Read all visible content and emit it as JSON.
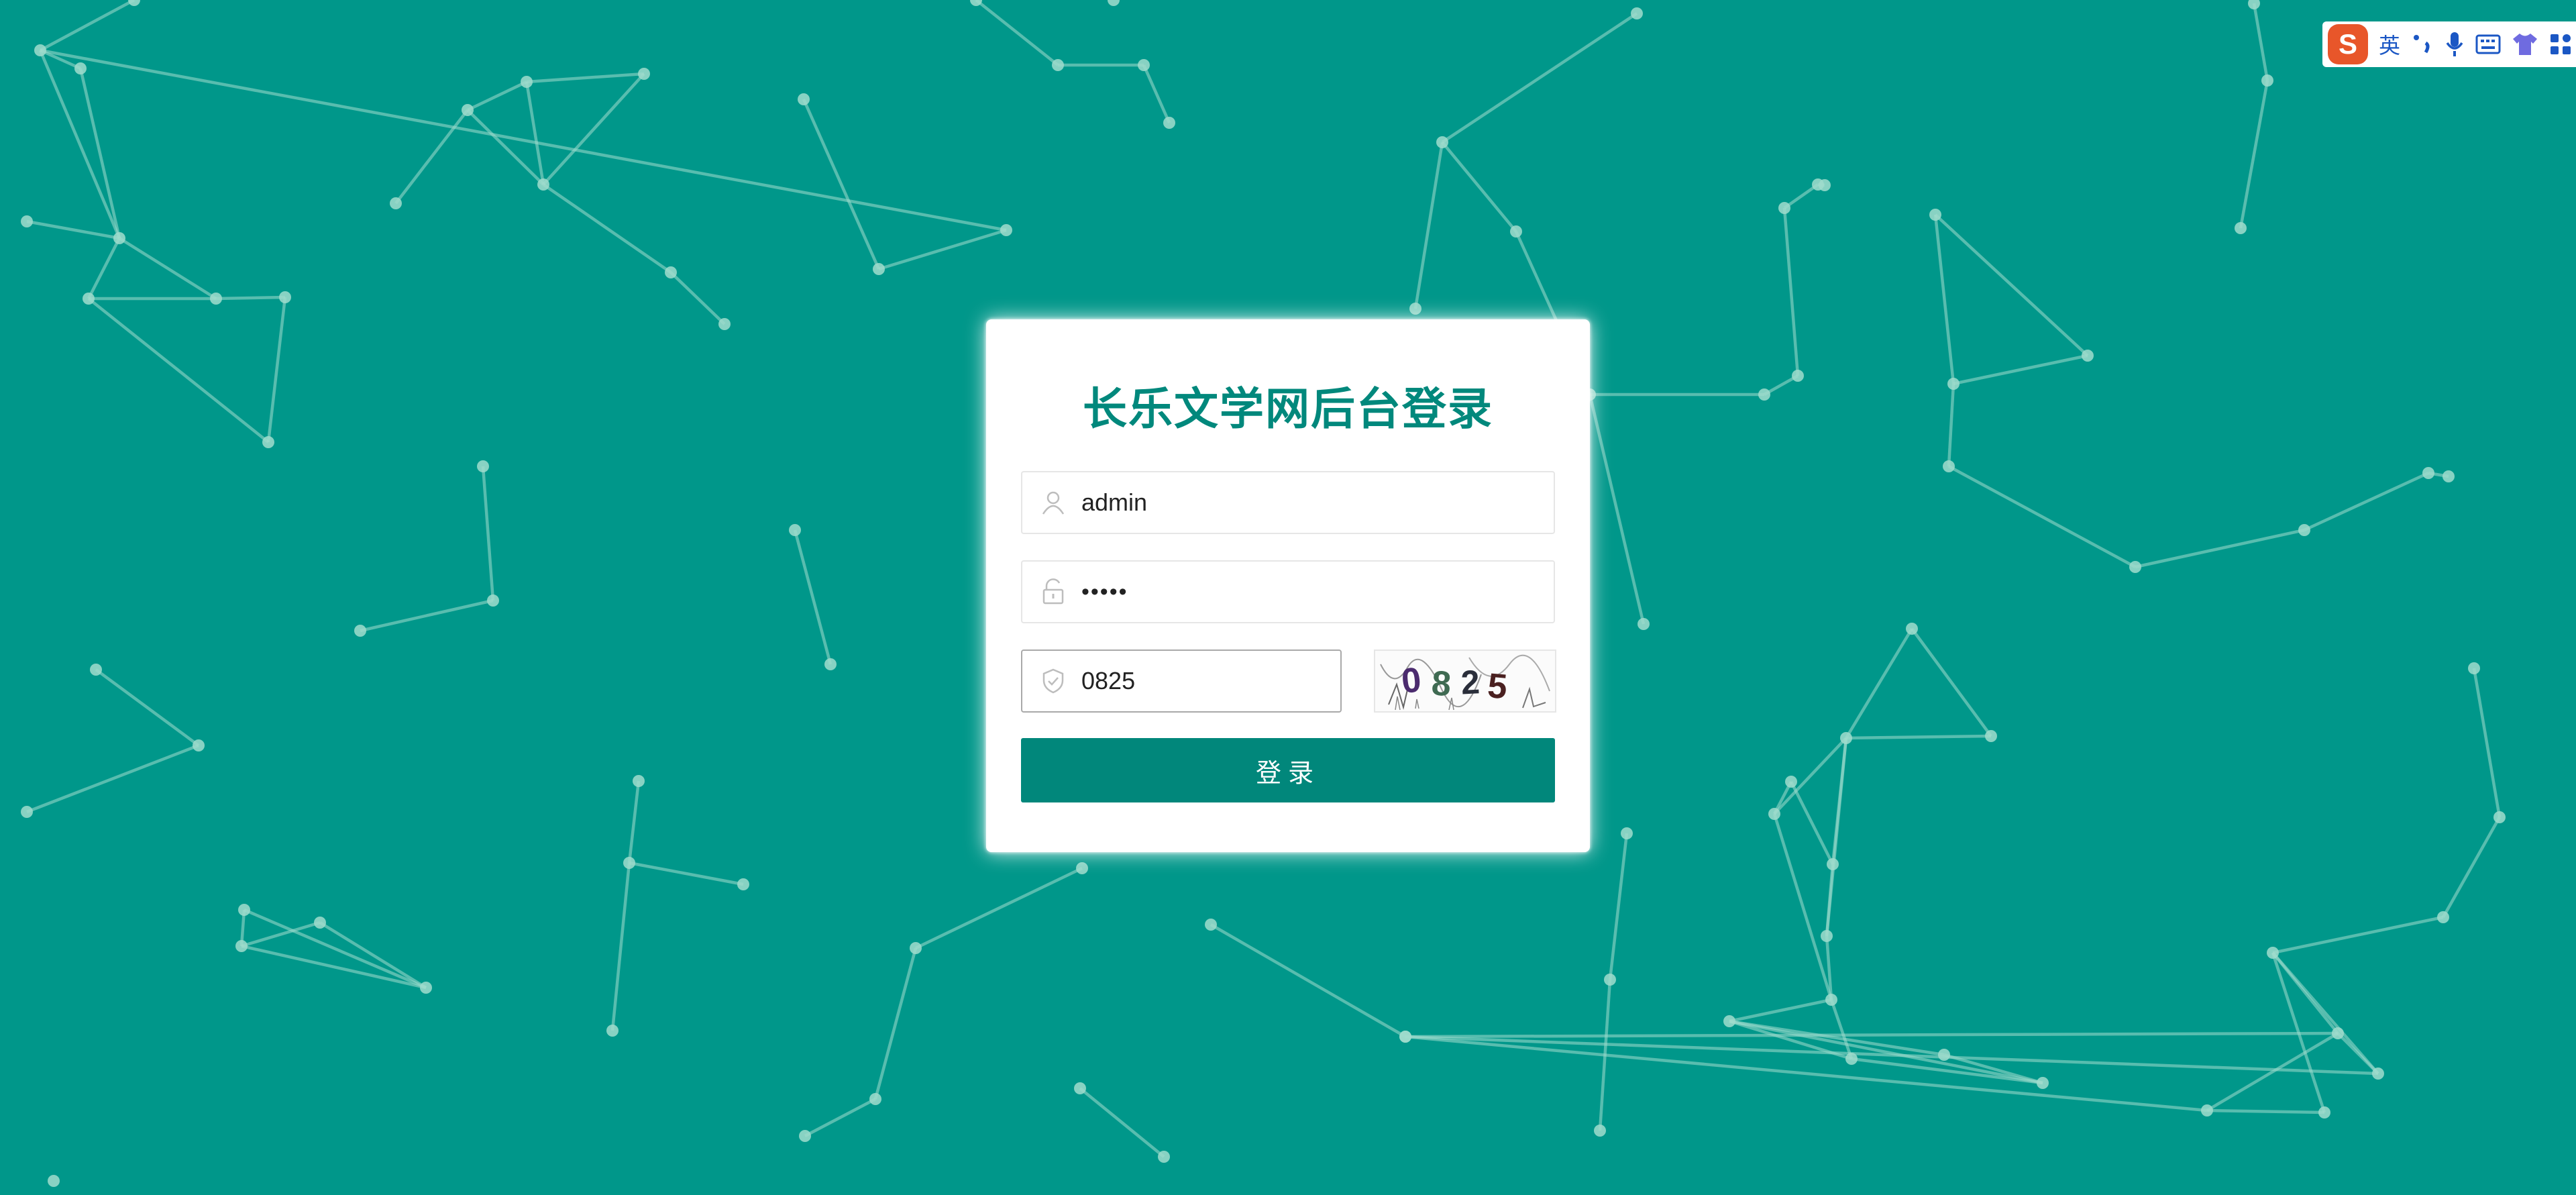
{
  "colors": {
    "background": "#00978a",
    "accent": "#01877b",
    "title": "#01887c",
    "network": "#a0dccd"
  },
  "ime_toolbar": {
    "logo": "S",
    "mode_label": "英",
    "icons": [
      "punctuation-icon",
      "microphone-icon",
      "keyboard-icon",
      "skin-shirt-icon",
      "toolbox-grid-icon"
    ]
  },
  "login": {
    "title": "长乐文学网后台登录",
    "username": {
      "value": "admin",
      "icon": "user-icon"
    },
    "password": {
      "value": "•••••",
      "icon": "unlock-icon"
    },
    "captcha": {
      "value": "0825",
      "icon": "shield-check-icon",
      "image_text": "0825"
    },
    "submit_label": "登录"
  }
}
